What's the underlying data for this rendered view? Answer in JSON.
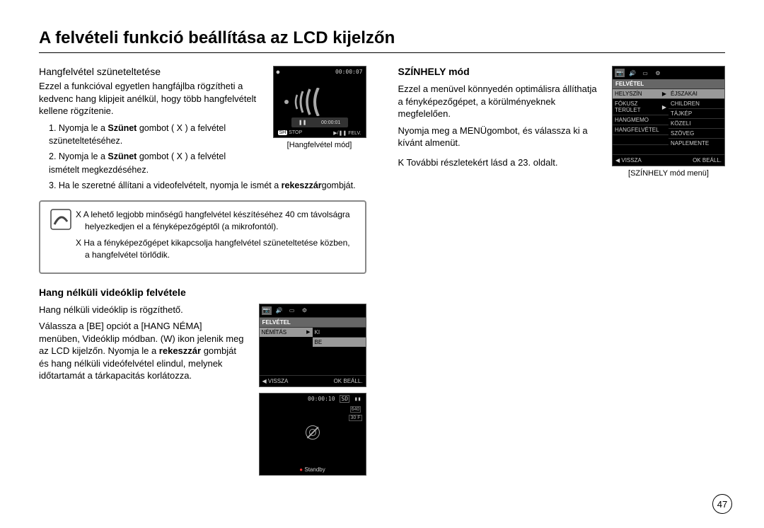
{
  "title": "A felvételi funkció beállítása az LCD kijelzőn",
  "left": {
    "pause_heading": "Hangfelvétel szüneteltetése",
    "pause_desc": "Ezzel a funkcióval egyetlen hangfájlba rögzítheti a kedvenc hang klipjeit anélkül, hogy több hangfelvételt kellene rögzítenie.",
    "step1a": "1. Nyomja le a ",
    "step1_bold": "Szünet",
    "step1b": " gombot ( X ) a felvétel szüneteltetéséhez.",
    "step2a": "2. Nyomja le a ",
    "step2_bold": "Szünet",
    "step2b": " gombot ( X ) a felvétel ismételt megkezdéséhez.",
    "step3a": "3. Ha le szeretné állítani a videofelvételt, nyomja le ismét a ",
    "step3_bold": "rekeszzár",
    "step3b": "gombját.",
    "lcd1_caption": "[Hangfelvétel mód]",
    "lcd1_time_top": "00:00:07",
    "lcd1_time_mid": "00:00:01",
    "lcd1_rec": "●",
    "lcd1_sh": "SH",
    "lcd1_stop": "STOP",
    "lcd1_play": "▶/❚❚ FELV.",
    "info1_pre": "X ",
    "info1": "A lehető legjobb minőségű hangfelvétel készítéséhez 40 cm távolságra helyezkedjen el a fényképezőgéptől (a mikrofontól).",
    "info2_pre": "X ",
    "info2": "Ha a fényképezőgépet kikapcsolja hangfelvétel szüneteltetése közben, a hangfelvétel törlődik.",
    "novoice_heading": "Hang nélküli videóklip felvétele",
    "novoice_line1": "Hang nélküli videóklip is rögzíthető.",
    "novoice_line2a": "Válassza a [BE] opciót a [HANG NÉMA] menüben, Videóklip módban. (W) ikon jelenik meg az LCD kijelzőn. Nyomja le a ",
    "novoice_line2_bold": "rekeszzár",
    "novoice_line2b": " gombját és hang nélküli videófelvétel elindul, melynek időtartamát a tárkapacitás korlátozza.",
    "menu_header": "FELVÉTEL",
    "menu_item1": "NÉMÍTÁS",
    "menu_opt_ki": "KI",
    "menu_opt_be": "BE",
    "menu_back": "◀ VISSZA",
    "menu_ok": "OK BEÁLL.",
    "lcd2_time": "00:00:10",
    "lcd2_sd": "SD",
    "lcd2_bat": "▮▮",
    "lcd2_640": "640",
    "lcd2_30f": "30 F",
    "lcd2_standby": "Standby"
  },
  "right": {
    "scene_heading": "SZÍNHELY mód",
    "scene_p1": "Ezzel a menüvel könnyedén optimálisra állíthatja a fényképezőgépet, a körülményeknek megfelelően.",
    "scene_p2": "Nyomja meg a MENÜgombot, és válassza ki a kívánt almenüt.",
    "scene_ref": "K További részletekért lásd a 23. oldalt.",
    "scene_lcd_caption": "[SZÍNHELY mód menü]",
    "scene_header": "FELVÉTEL",
    "scene_left_items": [
      "HELYSZÍN",
      "FÓKUSZ TERÜLET",
      "HANGMEMO",
      "HANGFELVÉTEL"
    ],
    "scene_right_items": [
      "ÉJSZAKAI",
      "CHILDREN",
      "TÁJKÉP",
      "KÖZELI",
      "SZÖVEG",
      "NAPLEMENTE"
    ],
    "scene_back": "◀ VISSZA",
    "scene_ok": "OK BEÁLL."
  },
  "page_number": "47"
}
